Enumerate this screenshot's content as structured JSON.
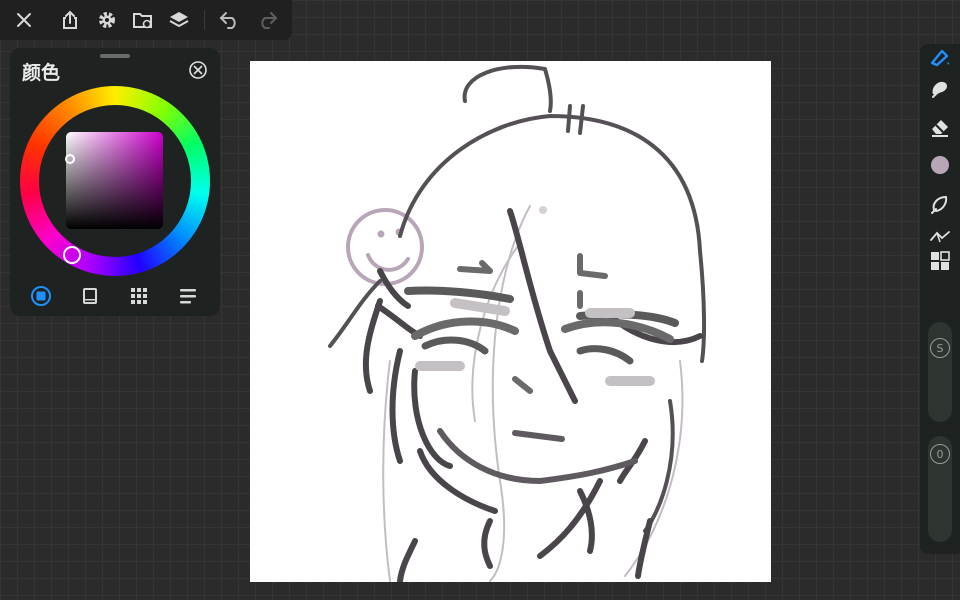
{
  "toolbar": {
    "icons": [
      "close-icon",
      "share-icon",
      "settings-icon",
      "folder-icon",
      "layers-icon",
      "undo-icon",
      "redo-icon"
    ]
  },
  "color_panel": {
    "title": "颜色",
    "current_color": "#b8a6b8",
    "mode_tabs": [
      "wheel-mode",
      "sliders-mode",
      "palette-mode",
      "history-mode"
    ],
    "active_tab": "wheel-mode"
  },
  "right_toolbar": {
    "tools": [
      "brush-icon",
      "smudge-icon",
      "eraser-icon",
      "color-swatch",
      "lasso-icon",
      "ruler-icon",
      "layers-grid-icon"
    ],
    "size_label": "S",
    "opacity_label": "0",
    "accent": "#1e90ff"
  }
}
